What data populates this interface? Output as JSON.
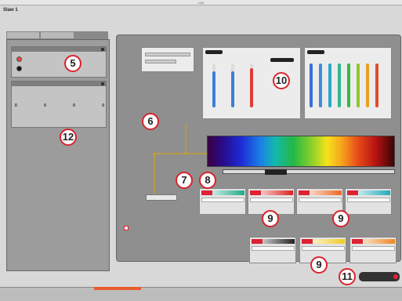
{
  "window": {
    "title": "LAS"
  },
  "header": {
    "title": "Slaw 1",
    "subtitle": ""
  },
  "tabs": [
    {
      "label": ""
    },
    {
      "label": ""
    },
    {
      "label": ""
    }
  ],
  "callouts": [
    "5",
    "6",
    "7",
    "8",
    "9",
    "9",
    "9",
    "10",
    "11",
    "12"
  ],
  "panels": {
    "top": {
      "title": "",
      "option_a": "",
      "option_b": ""
    },
    "bottom": {
      "title": "",
      "values": [
        "0",
        "0",
        "0",
        "0"
      ]
    }
  },
  "main": {
    "title": "",
    "button_label": ""
  },
  "pill": {
    "label": ""
  },
  "spectrum": {
    "fill_fraction": 1.0
  },
  "colors": {
    "accent_red": "#d9232e",
    "pane_gray": "#8f8f8f",
    "pill_dark": "#333333"
  },
  "icons": [
    "gear-icon",
    "close-icon",
    "radio-icon"
  ]
}
